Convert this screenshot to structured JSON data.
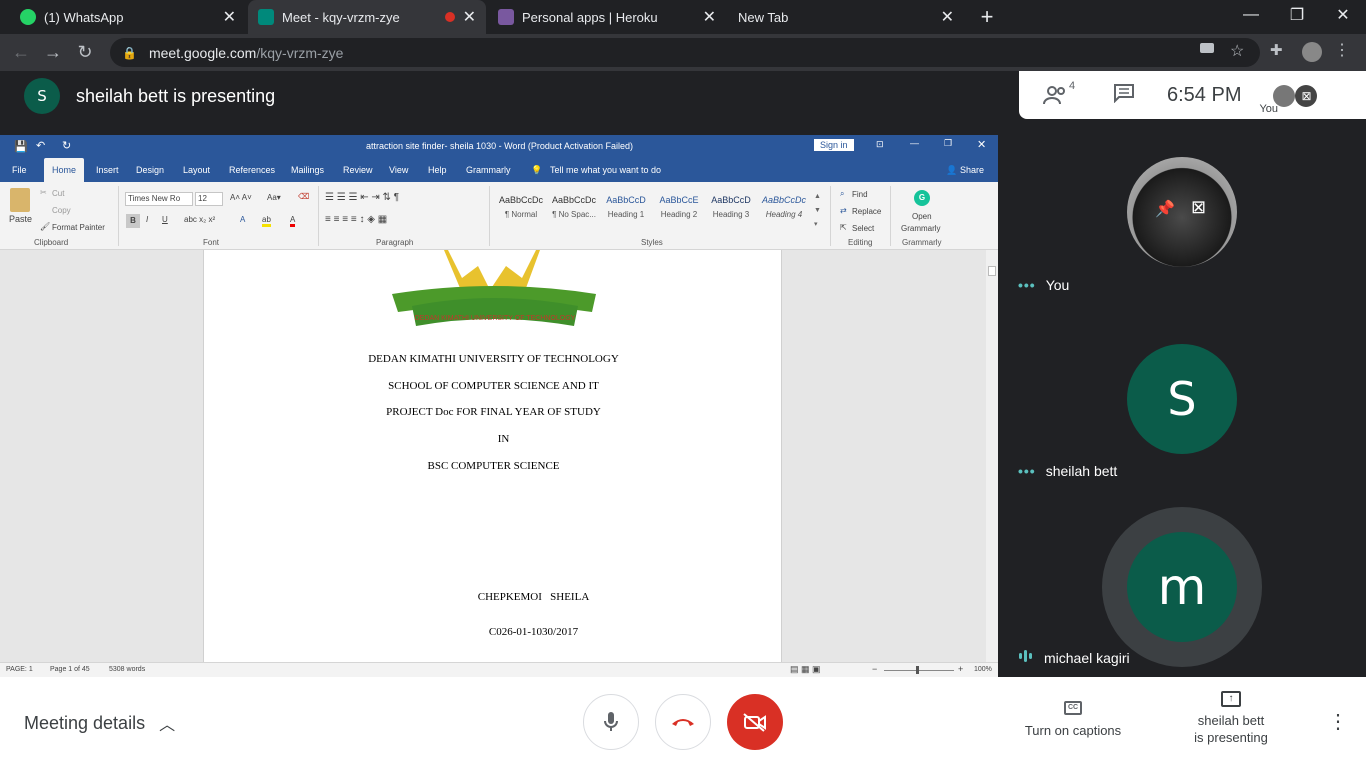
{
  "browser": {
    "tabs": [
      {
        "title": "(1) WhatsApp",
        "favicon_color": "#25d366"
      },
      {
        "title": "Meet - kqy-vrzm-zye",
        "favicon_color": "#00897b"
      },
      {
        "title": "Personal apps | Heroku",
        "favicon_color": "#79589f"
      },
      {
        "title": "New Tab",
        "favicon_color": ""
      }
    ],
    "url_host": "meet.google.com",
    "url_path": "/kqy-vrzm-zye"
  },
  "meet": {
    "presenter_initial": "S",
    "presenting_text": "sheilah bett is presenting",
    "participant_count": "4",
    "clock": "6:54 PM",
    "you_label": "You",
    "participants": [
      {
        "name": "You",
        "initial": ""
      },
      {
        "name": "sheilah bett",
        "initial": "S"
      },
      {
        "name": "michael kagiri",
        "initial": "m"
      }
    ],
    "meeting_details": "Meeting details",
    "captions": "Turn on captions",
    "presenting_line1": "sheilah bett",
    "presenting_line2": "is presenting",
    "accent_red": "#d93025"
  },
  "word": {
    "title": "attraction site finder- sheila 1030  -  Word (Product Activation Failed)",
    "sign_in": "Sign in",
    "share": "Share",
    "tabs": [
      "File",
      "Home",
      "Insert",
      "Design",
      "Layout",
      "References",
      "Mailings",
      "Review",
      "View",
      "Help",
      "Grammarly"
    ],
    "tell_me": "Tell me what you want to do",
    "clipboard": {
      "paste": "Paste",
      "cut": "Cut",
      "copy": "Copy",
      "format_painter": "Format Painter",
      "label": "Clipboard"
    },
    "font": {
      "name": "Times New Ro",
      "size": "12",
      "label": "Font"
    },
    "paragraph_label": "Paragraph",
    "styles": [
      {
        "preview": "AaBbCcDc",
        "name": "¶ Normal"
      },
      {
        "preview": "AaBbCcDc",
        "name": "¶ No Spac..."
      },
      {
        "preview": "AaBbCcD",
        "name": "Heading 1"
      },
      {
        "preview": "AaBbCcE",
        "name": "Heading 2"
      },
      {
        "preview": "AaBbCcD",
        "name": "Heading 3"
      },
      {
        "preview": "AaBbCcDc",
        "name": "Heading 4"
      }
    ],
    "styles_label": "Styles",
    "editing": {
      "find": "Find",
      "replace": "Replace",
      "select": "Select",
      "label": "Editing"
    },
    "grammarly": {
      "line1": "Open",
      "line2": "Grammarly",
      "label": "Grammarly"
    },
    "doc_lines": [
      "DEDAN KIMATHI UNIVERSITY OF TECHNOLOGY",
      "SCHOOL OF COMPUTER SCIENCE AND IT",
      "PROJECT Doc FOR FINAL YEAR OF STUDY",
      "IN",
      "BSC COMPUTER SCIENCE",
      "CHEPKEMOI   SHEILA",
      "C026-01-1030/2017"
    ],
    "logo_text": "DEDAN KIMATHI UNIVERSITY OF TECHNOLOGY",
    "status": {
      "page": "PAGE: 1",
      "page_of": "Page 1 of 45",
      "words": "5308 words",
      "zoom": "100%"
    }
  }
}
